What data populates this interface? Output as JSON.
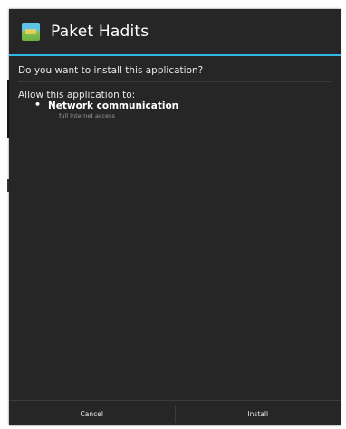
{
  "dialog": {
    "app_name": "Paket Hadits",
    "app_icon": "app-icon",
    "question": "Do you want to install this application?",
    "allow_heading": "Allow this application to:",
    "permissions": [
      {
        "bullet": "•",
        "title": "Network communication",
        "description": "full Internet access"
      }
    ],
    "accent_color": "#33b5e5",
    "background_color": "#262626"
  },
  "buttons": {
    "cancel_label": "Cancel",
    "install_label": "Install"
  }
}
